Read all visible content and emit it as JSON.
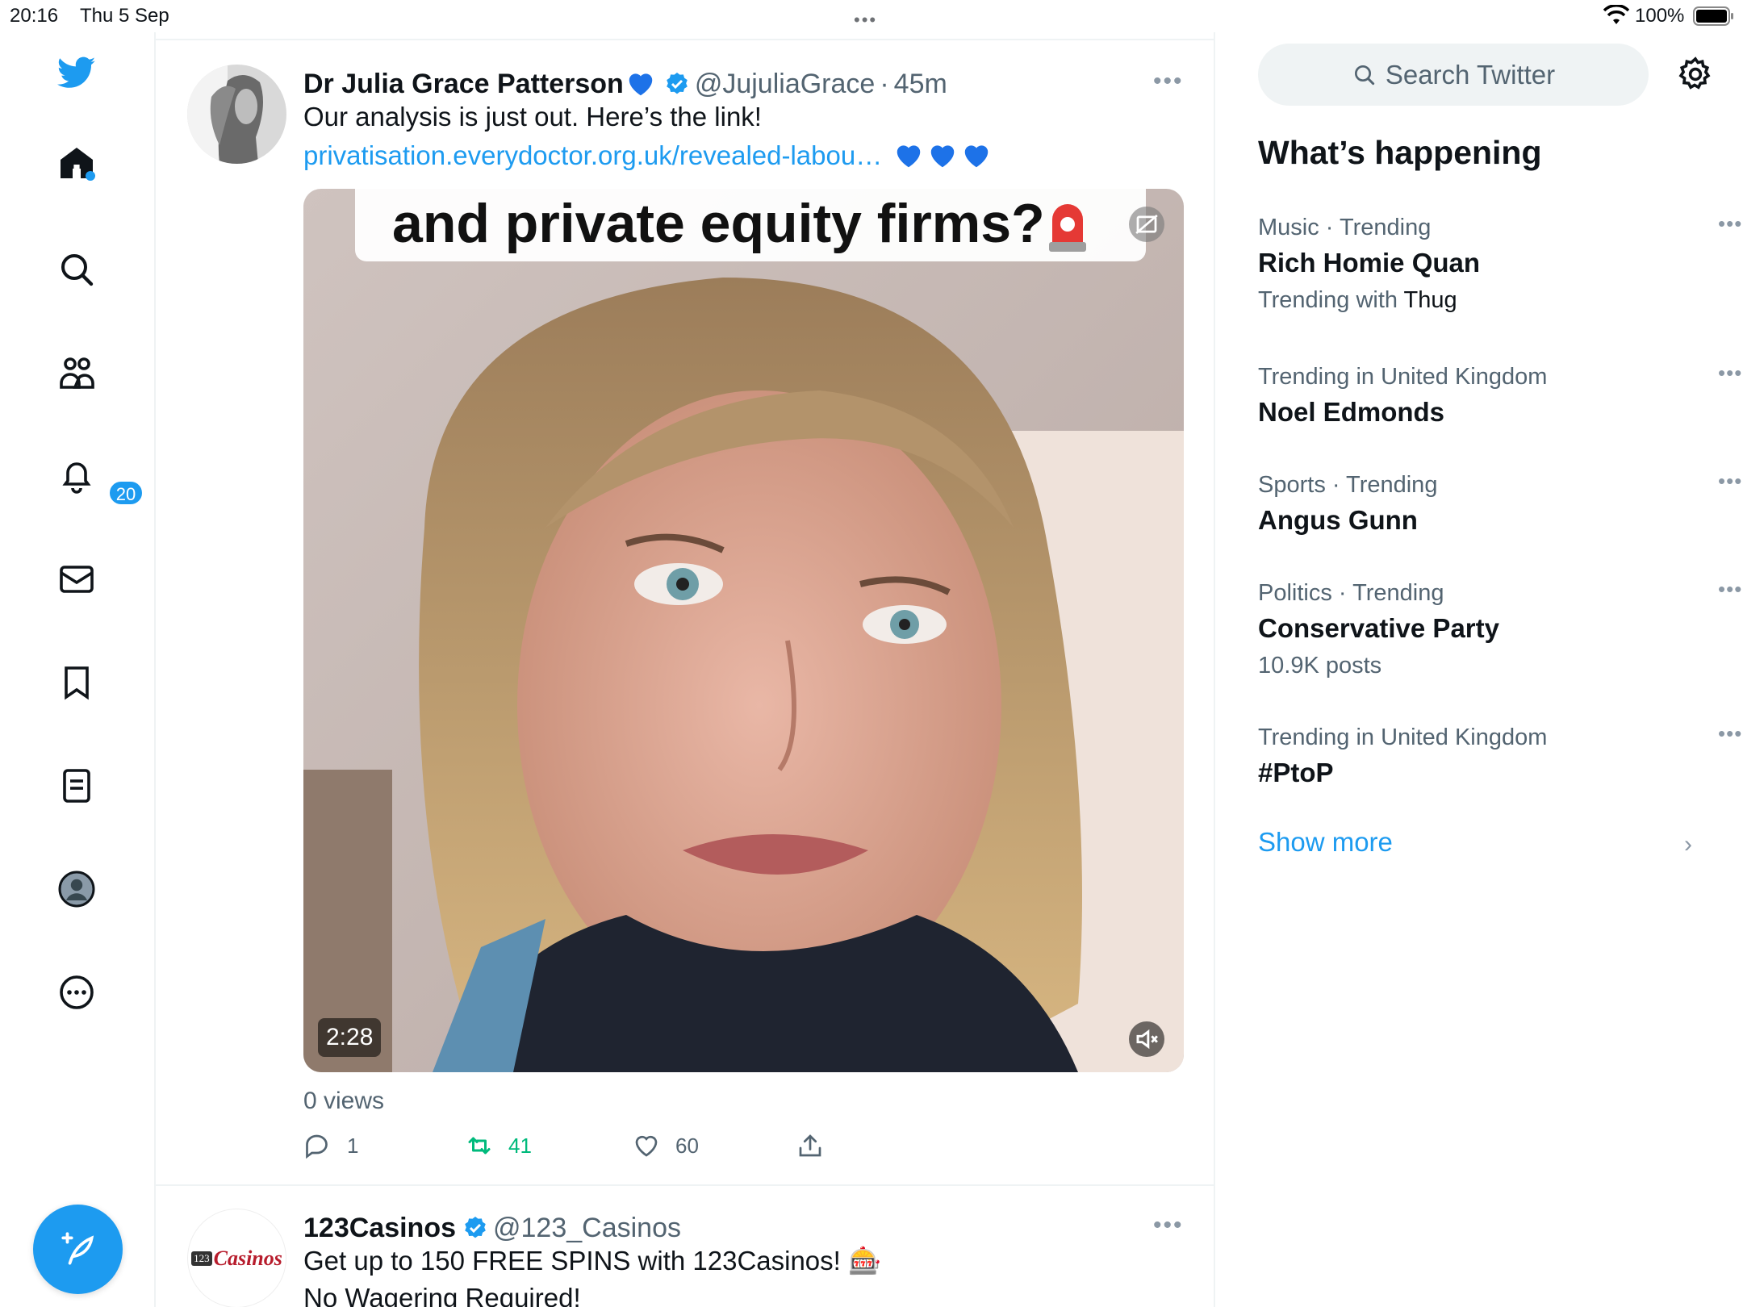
{
  "status": {
    "time": "20:16",
    "date": "Thu 5 Sep",
    "battery": "100%"
  },
  "nav": {
    "notifications_badge": "20"
  },
  "tweets": [
    {
      "name": "Dr Julia Grace Patterson",
      "handle": "@JujuliaGrace",
      "time": "45m",
      "text": "Our analysis is just out. Here’s the link!",
      "link": "privatisation.everydoctor.org.uk/revealed-labou…",
      "video_caption": "and private equity firms?",
      "duration": "2:28",
      "views": "0 views",
      "replies": "1",
      "retweets": "41",
      "likes": "60"
    },
    {
      "name": "123Casinos",
      "handle": "@123_Casinos",
      "avatar_text": "Casinos",
      "avatar_prefix": "123",
      "text": "Get up to 150 FREE SPINS with 123Casinos! 🎰",
      "text2": "No Wagering Required!"
    }
  ],
  "sidebar": {
    "search_placeholder": "Search Twitter",
    "title": "What’s happening",
    "trends": [
      {
        "context": "Music · Trending",
        "name": "Rich Homie Quan",
        "sub_prefix": "Trending with ",
        "sub_value": "Thug"
      },
      {
        "context": "Trending in United Kingdom",
        "name": "Noel Edmonds"
      },
      {
        "context": "Sports · Trending",
        "name": "Angus Gunn"
      },
      {
        "context": "Politics · Trending",
        "name": "Conservative Party",
        "sub_prefix": "10.9K posts"
      },
      {
        "context": "Trending in United Kingdom",
        "name": "#PtoP"
      }
    ],
    "show_more": "Show more"
  },
  "colors": {
    "accent": "#1d9bf0",
    "retweet": "#00ba7c",
    "secondary_text": "#536471"
  }
}
